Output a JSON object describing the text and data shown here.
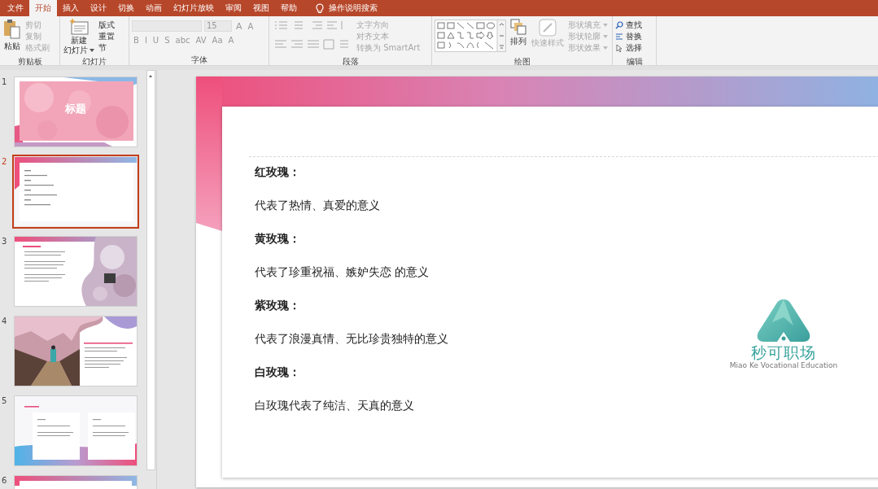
{
  "tabs": [
    {
      "label": "文件",
      "selected": false
    },
    {
      "label": "开始",
      "selected": true
    },
    {
      "label": "插入",
      "selected": false
    },
    {
      "label": "设计",
      "selected": false
    },
    {
      "label": "切换",
      "selected": false
    },
    {
      "label": "动画",
      "selected": false
    },
    {
      "label": "幻灯片放映",
      "selected": false
    },
    {
      "label": "审阅",
      "selected": false
    },
    {
      "label": "视图",
      "selected": false
    },
    {
      "label": "帮助",
      "selected": false
    }
  ],
  "search": {
    "label": "操作说明搜索"
  },
  "clipboard": {
    "label": "剪贴板",
    "paste": "粘贴",
    "items": [
      {
        "label": "剪切",
        "disabled": true
      },
      {
        "label": "复制",
        "disabled": true
      },
      {
        "label": "格式刷",
        "disabled": true
      }
    ]
  },
  "slides_group": {
    "label": "幻灯片",
    "new_slide": [
      "新建",
      "幻灯片"
    ],
    "items": [
      {
        "label": "版式"
      },
      {
        "label": "重置"
      },
      {
        "label": "节"
      }
    ]
  },
  "font": {
    "label": "字体",
    "size": "15",
    "size_buttons": [
      "A",
      "A"
    ],
    "format_buttons": [
      "B",
      "I",
      "U",
      "S",
      "abc",
      "AV",
      "Aa",
      "A"
    ]
  },
  "paragraph": {
    "label": "段落",
    "items": [
      {
        "label": "文字方向",
        "disabled": true
      },
      {
        "label": "对齐文本",
        "disabled": true
      },
      {
        "label": "转换为 SmartArt",
        "disabled": true
      }
    ]
  },
  "drawing": {
    "label": "绘图",
    "arrange": "排列",
    "quick_styles": "快速样式",
    "items": [
      {
        "label": "形状填充",
        "disabled": true
      },
      {
        "label": "形状轮廓",
        "disabled": true
      },
      {
        "label": "形状效果",
        "disabled": true
      }
    ]
  },
  "editing": {
    "label": "编辑",
    "items": [
      {
        "kind": "find",
        "label": "查找"
      },
      {
        "kind": "replace",
        "label": "替换"
      },
      {
        "kind": "select",
        "label": "选择"
      }
    ]
  },
  "thumbnails": [
    {
      "number": "1",
      "selected": false,
      "kind": "title",
      "title": "标题"
    },
    {
      "number": "2",
      "selected": true,
      "kind": "text"
    },
    {
      "number": "3",
      "selected": false,
      "kind": "photo-right"
    },
    {
      "number": "4",
      "selected": false,
      "kind": "photo-left"
    },
    {
      "number": "5",
      "selected": false,
      "kind": "columns"
    },
    {
      "number": "6",
      "selected": false,
      "kind": "header"
    }
  ],
  "slide": {
    "content": [
      {
        "kind": "heading",
        "text": "红玫瑰："
      },
      {
        "kind": "body",
        "text": "代表了热情、真爱的意义"
      },
      {
        "kind": "heading",
        "text": "黄玫瑰："
      },
      {
        "kind": "body",
        "text": "代表了珍重祝福、嫉妒失恋 的意义"
      },
      {
        "kind": "heading",
        "text": "紫玫瑰："
      },
      {
        "kind": "body",
        "text": "代表了浪漫真情、无比珍贵独特的意义"
      },
      {
        "kind": "heading",
        "text": "白玫瑰："
      },
      {
        "kind": "body",
        "text": "白玫瑰代表了纯洁、天真的意义"
      }
    ],
    "logo": {
      "name": "秒可职场",
      "tagline": "Miao Ke Vocational Education"
    }
  }
}
